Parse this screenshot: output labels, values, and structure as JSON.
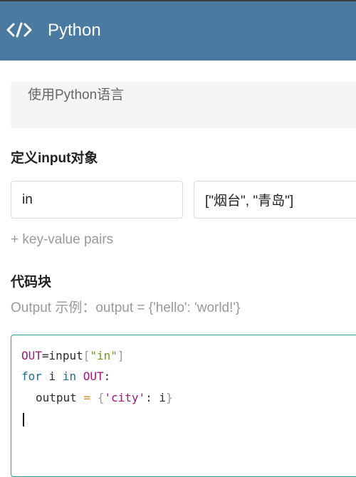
{
  "header": {
    "title": "Python",
    "icon": "code-icon"
  },
  "description": {
    "text": "使用Python语言"
  },
  "input_section": {
    "title": "定义input对象",
    "key_value": "in",
    "value_value": "[\"烟台\", \"青岛\"]",
    "add_pairs_label": "+ key-value pairs"
  },
  "code_section": {
    "title": "代码块",
    "hint": "Output 示例：output = {'hello': 'world!'}",
    "line1": {
      "var": "OUT",
      "eq": "=",
      "fn": "input",
      "lb": "[",
      "str": "\"in\"",
      "rb": "]"
    },
    "line2": {
      "kw_for": "for",
      "var_i": " i ",
      "kw_in": "in",
      "sp": " ",
      "out": "OUT",
      "colon": ":"
    },
    "line3": {
      "name": "output",
      "eq": " = ",
      "lb": "{",
      "key": "'city'",
      "colon": ": ",
      "val": "i",
      "rb": "}"
    }
  },
  "colors": {
    "header_bg": "#4a7aa0",
    "editor_border": "#2aa198",
    "hint_text": "#999999"
  }
}
